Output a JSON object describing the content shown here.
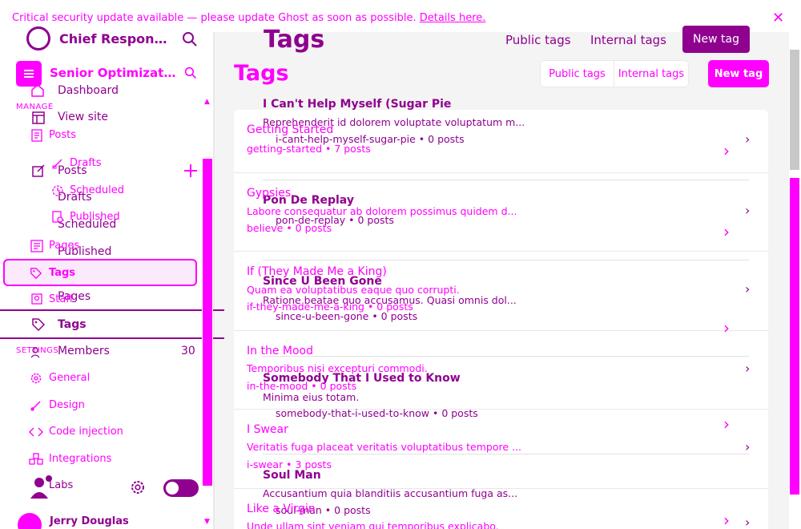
{
  "banner": {
    "text": "Critical security update available — please update Ghost as soon as possible.",
    "link": "Details here."
  },
  "sidebar_back": {
    "site_title": "Chief Response ...",
    "nav": {
      "dashboard": "Dashboard",
      "view_site": "View site",
      "posts": "Posts",
      "drafts": "Drafts",
      "scheduled": "Scheduled",
      "published": "Published",
      "pages": "Pages",
      "tags": "Tags"
    },
    "settings_label": "SETTINGS"
  },
  "sidebar": {
    "site_title": "Senior Optimizatio...",
    "manage_label": "MANAGE",
    "nav": {
      "posts": "Posts",
      "drafts": "Drafts",
      "scheduled": "Scheduled",
      "published": "Published",
      "pages": "Pages",
      "tags": "Tags",
      "staff": "Staff",
      "members": "Members",
      "members_count": "30",
      "general": "General",
      "design": "Design",
      "code_injection": "Code injection",
      "integrations": "Integrations",
      "labs": "Labs"
    },
    "user_name": "Jerry Douglas"
  },
  "header_back": {
    "title": "Tags",
    "public_tags": "Public tags",
    "internal_tags": "Internal tags",
    "new_tag": "New tag"
  },
  "header": {
    "title": "Tags",
    "public_tags": "Public tags",
    "internal_tags": "Internal tags",
    "new_tag": "New tag"
  },
  "tags_front": [
    {
      "name": "Getting Started",
      "desc": "",
      "meta": "getting-started • 7 posts"
    },
    {
      "name": "Gypsies",
      "desc": "Labore consequatur ab dolorem possimus quidem d...",
      "meta": "believe • 0 posts"
    },
    {
      "name": "If (They Made Me a King)",
      "desc": "Quam ea voluptatibus eaque quo corrupti.",
      "meta": "if-they-made-me-a-king • 0 posts"
    },
    {
      "name": "In the Mood",
      "desc": "Temporibus nisi excepturi commodi.",
      "meta": "in-the-mood • 0 posts"
    },
    {
      "name": "I Swear",
      "desc": "Veritatis fuga placeat veritatis voluptatibus tempore ...",
      "meta": "i-swear • 3 posts"
    },
    {
      "name": "Like a Virgin",
      "desc": "Unde ullam sint veniam qui temporibus explicabo.",
      "meta": ""
    }
  ],
  "tags_back": [
    {
      "name": "I Can't Help Myself (Sugar Pie",
      "desc": "Reprehenderit id dolorem voluptate voluptatum m...",
      "meta": "i-cant-help-myself-sugar-pie • 0 posts"
    },
    {
      "name": "Pon De Replay",
      "desc": "",
      "meta": "pon-de-replay • 0 posts"
    },
    {
      "name": "Since U Been Gone",
      "desc": "Ratione beatae quo accusamus. Quasi omnis dol...",
      "meta": "since-u-been-gone • 0 posts"
    },
    {
      "name": "Somebody That I Used to Know",
      "desc": "Minima eius totam.",
      "meta": "somebody-that-i-used-to-know • 0 posts"
    },
    {
      "name": "Soul Man",
      "desc": "Accusantium quia blanditiis accusantium fuga as...",
      "meta": "soul-man • 0 posts"
    }
  ]
}
